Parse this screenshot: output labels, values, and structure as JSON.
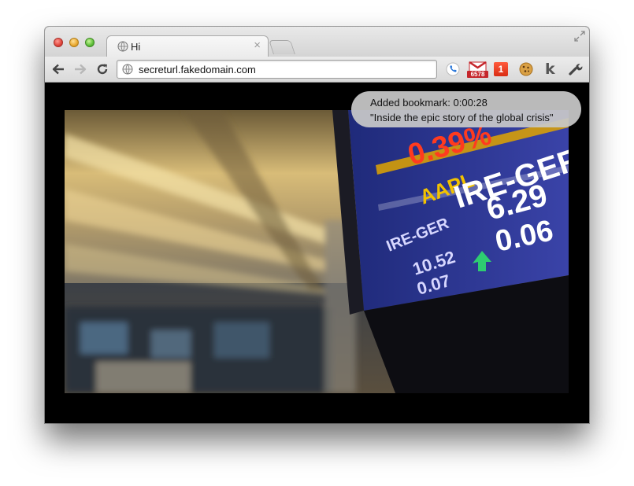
{
  "browser": {
    "tab": {
      "title": "Hi",
      "close_glyph": "×"
    },
    "omnibox": {
      "url": "secreturl.fakedomain.com"
    },
    "extensions": {
      "gmail_count": "6578",
      "notification_count": "1",
      "klout_letter": "k",
      "icons": [
        "phone-icon",
        "gmail-icon",
        "notification-badge-icon",
        "cookie-icon",
        "klout-icon",
        "wrench-icon"
      ]
    },
    "nav_icons": [
      "back-arrow-icon",
      "forward-arrow-icon",
      "reload-icon"
    ]
  },
  "video": {
    "ticker": {
      "symbols": [
        "AAPL",
        "IRE-GER",
        "IRE-GER"
      ],
      "values": [
        "0.39%",
        "6.29",
        "0.06",
        "10.52",
        "0.07"
      ]
    }
  },
  "toast": {
    "line1": "Added bookmark: 0:00:28",
    "line2": "\"Inside the epic story of the global crisis\""
  },
  "colors": {
    "close": "#e0443a",
    "minimize": "#e9a82e",
    "maximize": "#5fbf3a",
    "gmail_red": "#c5262b",
    "badge_red": "#d92d14",
    "ticker_blue": "#2a2f8f"
  }
}
